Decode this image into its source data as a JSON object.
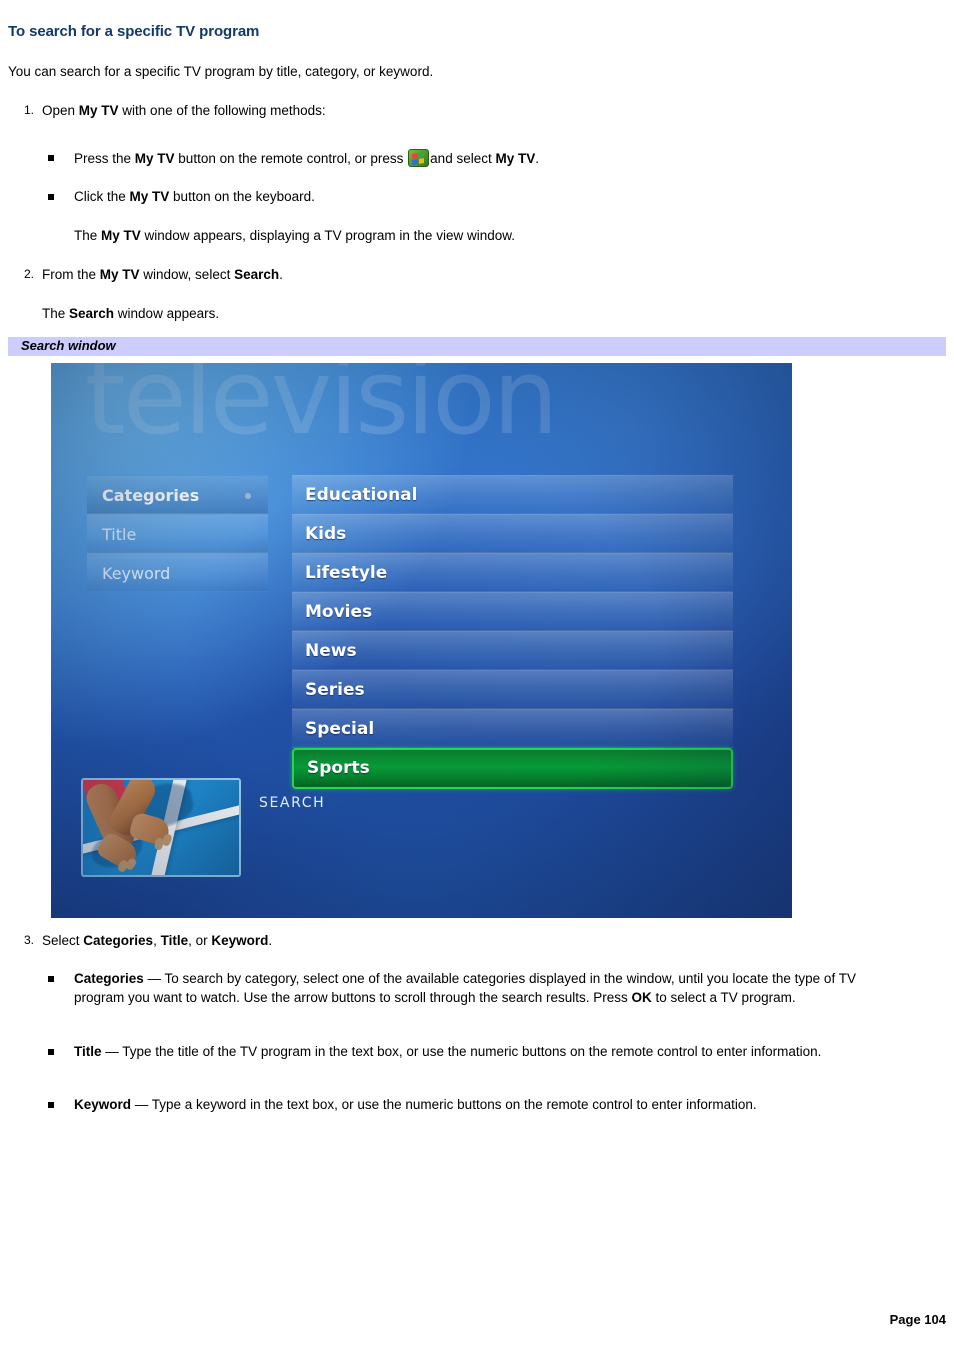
{
  "document": {
    "heading": "To search for a specific TV program",
    "intro": "You can search for a specific TV program by title, category, or keyword.",
    "footer": "Page 104"
  },
  "steps": {
    "step1": {
      "number": "1.",
      "text_before": "Open ",
      "bold1": "My TV",
      "text_after": " with one of the following methods:"
    },
    "step1_sub1": {
      "part1": "Press the ",
      "bold1": "My TV",
      "part2": " button on the remote control, or press ",
      "icon": "windows-start-icon",
      "part3": "and select ",
      "bold2": "My TV",
      "part4": "."
    },
    "step1_sub2": {
      "part1": "Click the ",
      "bold1": "My TV",
      "part2": " button on the keyboard."
    },
    "step1_note": {
      "part1": "The ",
      "bold1": "My TV",
      "part2": " window appears, displaying a TV program in the view window."
    },
    "step2": {
      "number": "2.",
      "part1": "From the ",
      "bold1": "My TV",
      "part2": " window, select ",
      "bold2": "Search",
      "part3": "."
    },
    "step2_note": {
      "part1": "The ",
      "bold1": "Search",
      "part2": " window appears."
    },
    "step3": {
      "number": "3.",
      "part1": "Select ",
      "bold1": "Categories",
      "part2": ", ",
      "bold2": "Title",
      "part3": ", or ",
      "bold3": "Keyword",
      "part4": "."
    },
    "step3_sub1": {
      "bold1": "Categories",
      "text": " — To search by category, select one of the available categories displayed in the window, until you locate the type of TV program you want to watch. Use the arrow buttons to scroll through the search results. Press ",
      "bold2": "OK",
      "text2": " to select a TV program."
    },
    "step3_sub2": {
      "bold1": "Title",
      "text": " — Type the title of the TV program in the text box, or use the numeric buttons on the remote control to enter information."
    },
    "step3_sub3": {
      "bold1": "Keyword",
      "text": " — Type a keyword in the text box, or use the numeric buttons on the remote control to enter information."
    }
  },
  "figure": {
    "caption": "Search window",
    "caption_bg": "#ccccff",
    "watermark": "television",
    "search_label": "SEARCH",
    "menu": [
      {
        "label": "Categories",
        "selected": true
      },
      {
        "label": "Title",
        "selected": false
      },
      {
        "label": "Keyword",
        "selected": false
      }
    ],
    "categories": [
      {
        "label": "Educational",
        "highlighted": false
      },
      {
        "label": "Kids",
        "highlighted": false
      },
      {
        "label": "Lifestyle",
        "highlighted": false
      },
      {
        "label": "Movies",
        "highlighted": false
      },
      {
        "label": "News",
        "highlighted": false
      },
      {
        "label": "Series",
        "highlighted": false
      },
      {
        "label": "Special",
        "highlighted": false
      },
      {
        "label": "Sports",
        "highlighted": true
      }
    ],
    "thumbnail_alt": "sprinter hands on starting line of blue running track",
    "colors": {
      "heading": "#13386b",
      "highlight_green": "#089a38",
      "highlight_border": "#27d453",
      "screen_blue": "#2459b4"
    }
  }
}
